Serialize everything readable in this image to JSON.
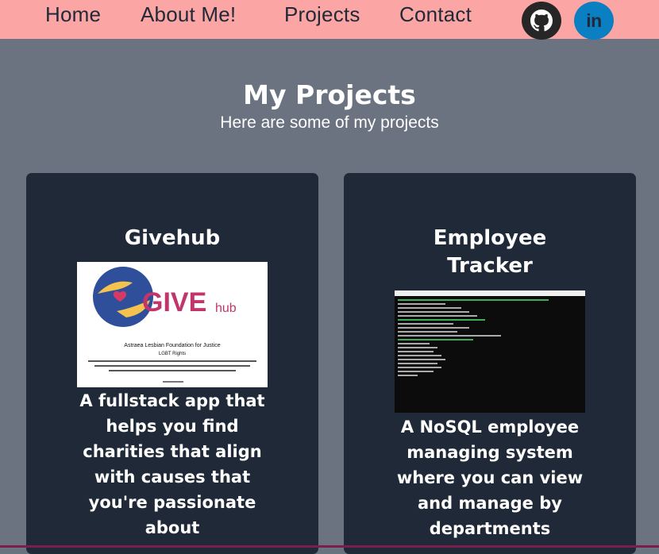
{
  "nav": {
    "links": [
      "Home",
      "About Me!",
      "Projects",
      "Contact"
    ],
    "social": [
      {
        "name": "github",
        "icon": "github-icon"
      },
      {
        "name": "linkedin",
        "icon": "linkedin-icon",
        "label": "in"
      }
    ]
  },
  "main": {
    "title": "My Projects",
    "subtitle": "Here are some of my projects"
  },
  "projects": [
    {
      "title": "Givehub",
      "image_logo": "GIVE",
      "image_logo_suffix": "hub",
      "image_caption_1": "Astraea Lesbian Foundation for Justice",
      "image_caption_2": "LGBT Rights",
      "description_lines": [
        "A fullstack app that",
        "helps you find",
        "charities that align",
        "with causes that",
        "you're passionate",
        "about"
      ]
    },
    {
      "title_lines": [
        "Employee",
        "Tracker"
      ],
      "description_lines": [
        "A NoSQL employee",
        "managing system",
        "where you can view",
        "and manage by",
        "departments"
      ]
    }
  ],
  "colors": {
    "nav_bg": "#fca5a5",
    "page_bg": "#6b7280",
    "card_bg": "#1f2937",
    "github_bg": "#262626",
    "linkedin_bg": "#0a7fc1"
  }
}
